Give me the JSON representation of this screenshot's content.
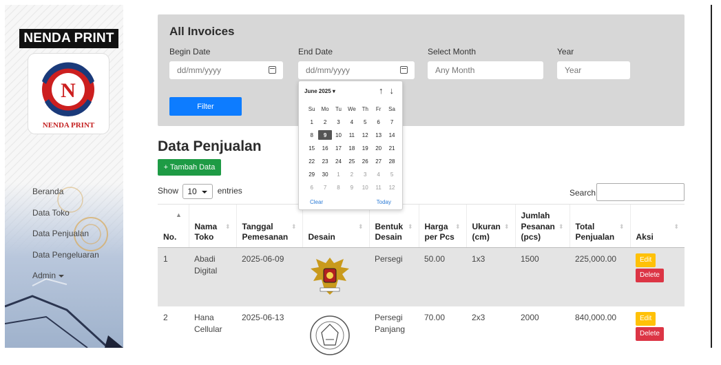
{
  "sidebar": {
    "brand": "NENDA PRINT",
    "logo_text": "NENDA PRINT",
    "nav": [
      {
        "label": "Beranda"
      },
      {
        "label": "Data Toko"
      },
      {
        "label": "Data Penjualan"
      },
      {
        "label": "Data Pengeluaran"
      },
      {
        "label": "Admin"
      }
    ]
  },
  "filter": {
    "title": "All Invoices",
    "begin_label": "Begin Date",
    "begin_placeholder": "dd/mm/yyyy",
    "end_label": "End Date",
    "end_placeholder": "dd/mm/yyyy",
    "month_label": "Select Month",
    "month_value": "Any Month",
    "year_label": "Year",
    "year_placeholder": "Year",
    "button": "Filter"
  },
  "datepicker": {
    "month_year": "June 2025 ▾",
    "weekdays": [
      "Su",
      "Mo",
      "Tu",
      "We",
      "Th",
      "Fr",
      "Sa"
    ],
    "days": [
      {
        "d": "1",
        "m": false
      },
      {
        "d": "2",
        "m": false
      },
      {
        "d": "3",
        "m": false
      },
      {
        "d": "4",
        "m": false
      },
      {
        "d": "5",
        "m": false
      },
      {
        "d": "6",
        "m": false
      },
      {
        "d": "7",
        "m": false
      },
      {
        "d": "8",
        "m": false
      },
      {
        "d": "9",
        "m": false,
        "sel": true
      },
      {
        "d": "10",
        "m": false
      },
      {
        "d": "11",
        "m": false
      },
      {
        "d": "12",
        "m": false
      },
      {
        "d": "13",
        "m": false
      },
      {
        "d": "14",
        "m": false
      },
      {
        "d": "15",
        "m": false
      },
      {
        "d": "16",
        "m": false
      },
      {
        "d": "17",
        "m": false
      },
      {
        "d": "18",
        "m": false
      },
      {
        "d": "19",
        "m": false
      },
      {
        "d": "20",
        "m": false
      },
      {
        "d": "21",
        "m": false
      },
      {
        "d": "22",
        "m": false
      },
      {
        "d": "23",
        "m": false
      },
      {
        "d": "24",
        "m": false
      },
      {
        "d": "25",
        "m": false
      },
      {
        "d": "26",
        "m": false
      },
      {
        "d": "27",
        "m": false
      },
      {
        "d": "28",
        "m": false
      },
      {
        "d": "29",
        "m": false
      },
      {
        "d": "30",
        "m": false
      },
      {
        "d": "1",
        "m": true
      },
      {
        "d": "2",
        "m": true
      },
      {
        "d": "3",
        "m": true
      },
      {
        "d": "4",
        "m": true
      },
      {
        "d": "5",
        "m": true
      },
      {
        "d": "6",
        "m": true
      },
      {
        "d": "7",
        "m": true
      },
      {
        "d": "8",
        "m": true
      },
      {
        "d": "9",
        "m": true
      },
      {
        "d": "10",
        "m": true
      },
      {
        "d": "11",
        "m": true
      },
      {
        "d": "12",
        "m": true
      }
    ],
    "clear": "Clear",
    "today": "Today"
  },
  "content": {
    "title": "Data Penjualan",
    "add_button": "+ Tambah Data",
    "show_label": "Show",
    "entries_value": "10",
    "entries_label": "entries",
    "search_label": "Search:"
  },
  "table": {
    "headers": [
      "No.",
      "Nama Toko",
      "Tanggal Pemesanan",
      "Desain",
      "Bentuk Desain",
      "Harga per Pcs",
      "Ukuran (cm)",
      "Jumlah Pesanan (pcs)",
      "Total Penjualan",
      "Aksi"
    ],
    "rows": [
      {
        "no": "1",
        "toko": "Abadi Digital",
        "tanggal": "2025-06-09",
        "bentuk": "Persegi",
        "harga": "50.00",
        "ukuran": "1x3",
        "jumlah": "1500",
        "total": "225,000.00"
      },
      {
        "no": "2",
        "toko": "Hana Cellular",
        "tanggal": "2025-06-13",
        "bentuk": "Persegi Panjang",
        "harga": "70.00",
        "ukuran": "2x3",
        "jumlah": "2000",
        "total": "840,000.00"
      }
    ],
    "edit_label": "Edit",
    "delete_label": "Delete"
  }
}
